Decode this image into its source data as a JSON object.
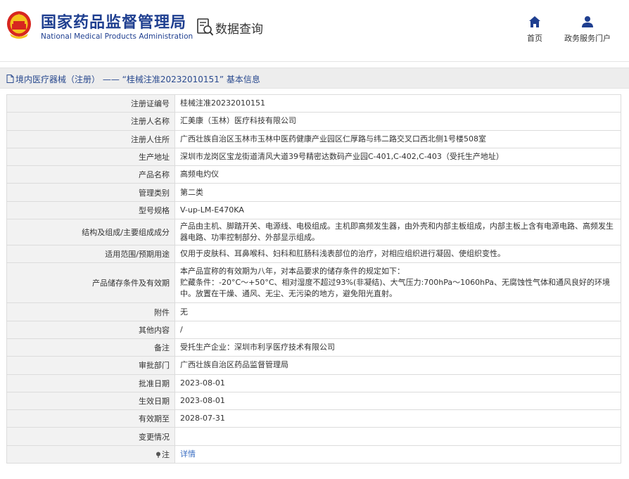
{
  "header": {
    "title_cn": "国家药品监督管理局",
    "title_en": "National Medical Products Administration",
    "query_title": "数据查询",
    "nav": [
      {
        "label": "首页",
        "icon": "home-icon"
      },
      {
        "label": "政务服务门户",
        "icon": "user-icon"
      }
    ]
  },
  "breadcrumb": "境内医疗器械（注册） —— “桂械注准20232010151” 基本信息",
  "rows": [
    {
      "label": "注册证编号",
      "value": "桂械注准20232010151"
    },
    {
      "label": "注册人名称",
      "value": "汇美康（玉林）医疗科技有限公司"
    },
    {
      "label": "注册人住所",
      "value": "广西壮族自治区玉林市玉林中医药健康产业园区仁厚路与纬二路交叉口西北侧1号楼508室"
    },
    {
      "label": "生产地址",
      "value": "深圳市龙岗区宝龙街道清风大道39号精密达数码产业园C-401,C-402,C-403（受托生产地址）"
    },
    {
      "label": "产品名称",
      "value": "高频电灼仪"
    },
    {
      "label": "管理类别",
      "value": "第二类"
    },
    {
      "label": "型号规格",
      "value": "V-up-LM-E470KA"
    },
    {
      "label": "结构及组成/主要组成成分",
      "value": "产品由主机、脚踏开关、电源线、电极组成。主机即高频发生器，由外壳和内部主板组成，内部主板上含有电源电路、高频发生器电路、功率控制部分、外部显示组成。"
    },
    {
      "label": "适用范围/预期用途",
      "value": "仅用于皮肤科、耳鼻喉科、妇科和肛肠科浅表部位的治疗，对相应组织进行凝固、使组织变性。"
    },
    {
      "label": "产品储存条件及有效期",
      "value": "本产品宣称的有效期为八年，对本品要求的储存条件的规定如下：\n贮藏条件：-20°C～+50°C、相对湿度不超过93%(非凝结)、大气压力:700hPa～1060hPa、无腐蚀性气体和通风良好的环境中。放置在干燥、通风、无尘、无污染的地方，避免阳光直射。"
    },
    {
      "label": "附件",
      "value": "无"
    },
    {
      "label": "其他内容",
      "value": "/"
    },
    {
      "label": "备注",
      "value": "受托生产企业：深圳市利孚医疗技术有限公司"
    },
    {
      "label": "审批部门",
      "value": "广西壮族自治区药品监督管理局"
    },
    {
      "label": "批准日期",
      "value": "2023-08-01"
    },
    {
      "label": "生效日期",
      "value": "2023-08-01"
    },
    {
      "label": "有效期至",
      "value": "2028-07-31"
    },
    {
      "label": "变更情况",
      "value": ""
    },
    {
      "label": "注",
      "value": "详情"
    }
  ],
  "colors": {
    "brand_blue": "#1f3f90",
    "emblem_red": "#d7261f",
    "link_blue": "#3a6ec2"
  }
}
